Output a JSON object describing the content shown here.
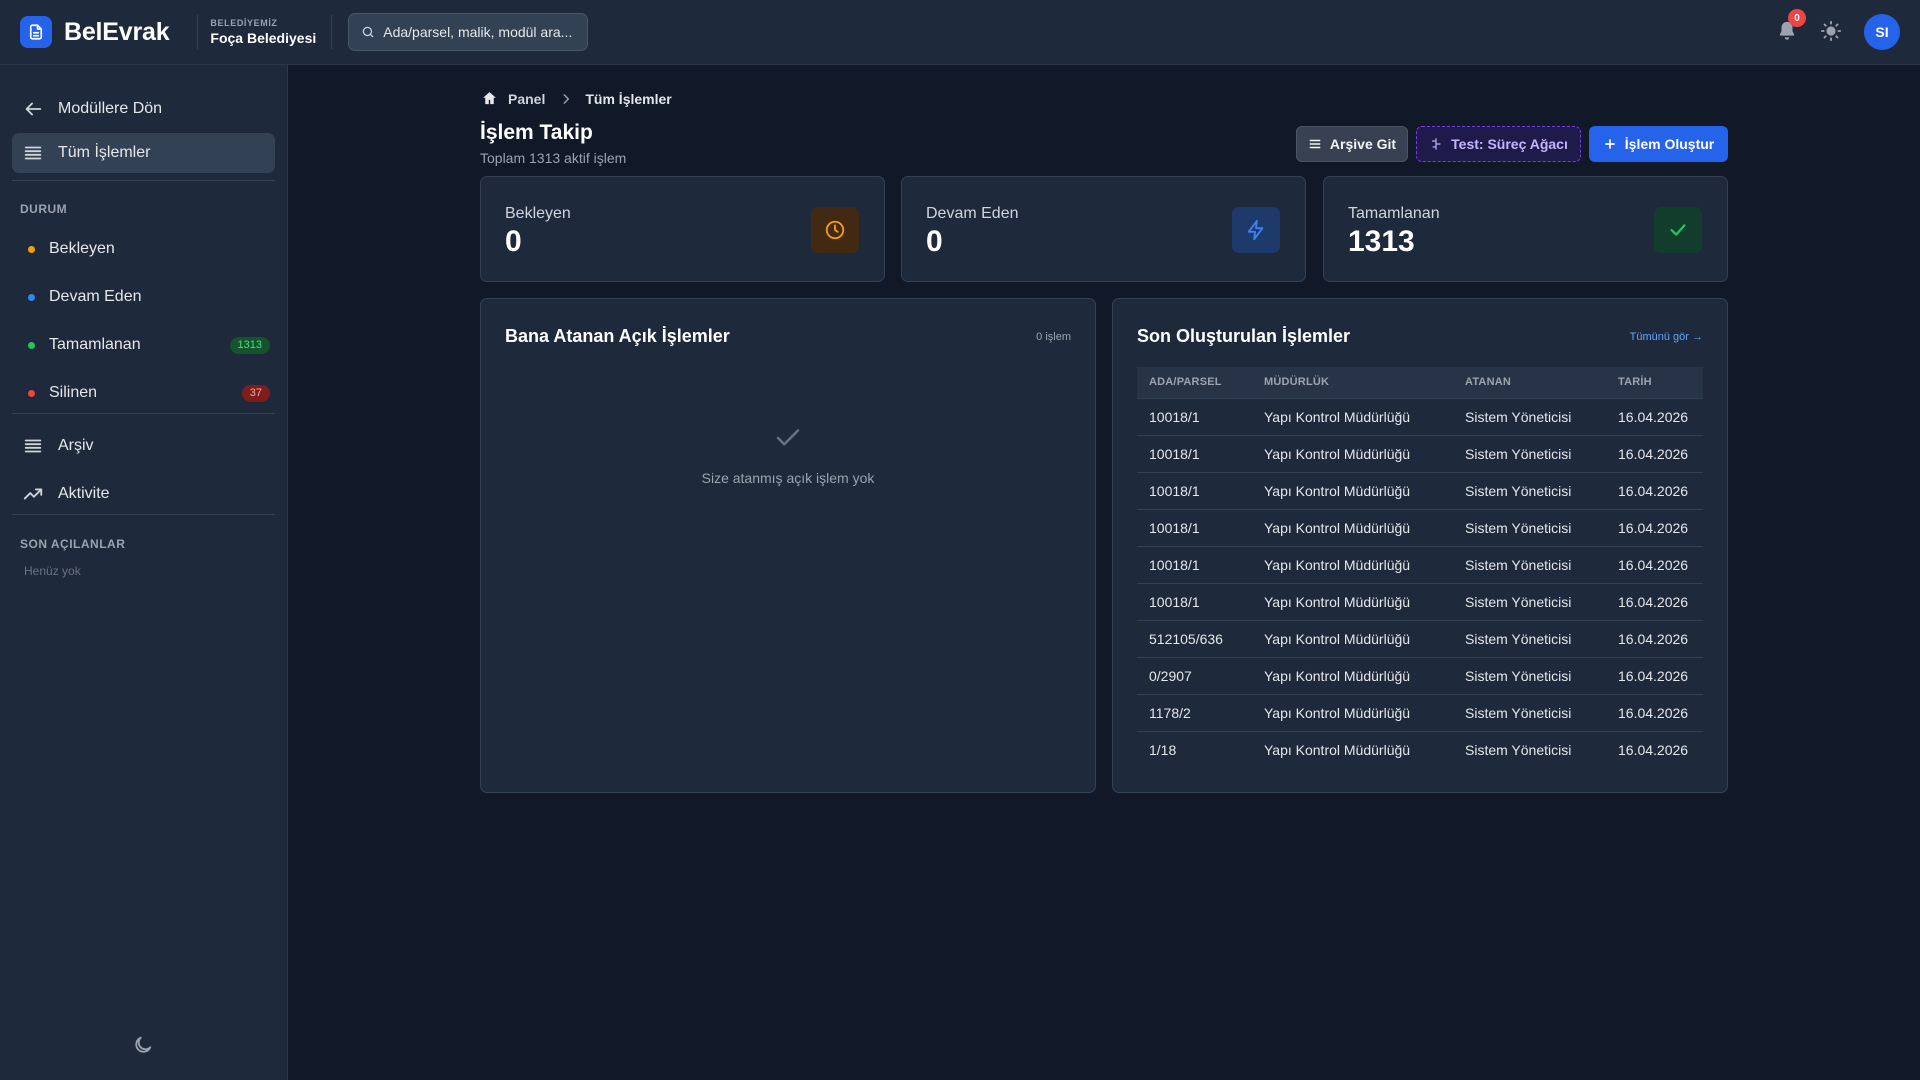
{
  "app": {
    "name": "BelEvrak",
    "municipality_eyebrow": "BELEDİYEMİZ",
    "municipality_name": "Foça Belediyesi"
  },
  "search": {
    "placeholder": "Ada/parsel, malik, modül ara..."
  },
  "header": {
    "notification_count": "0",
    "avatar_initials": "SI"
  },
  "sidebar": {
    "back_label": "Modüllere Dön",
    "all_label": "Tüm İşlemler",
    "status_heading": "DURUM",
    "statuses": [
      {
        "label": "Bekleyen",
        "color": "#f59e0b",
        "count": ""
      },
      {
        "label": "Devam Eden",
        "color": "#3b82f6",
        "count": ""
      },
      {
        "label": "Tamamlanan",
        "color": "#22c55e",
        "count": "1313"
      },
      {
        "label": "Silinen",
        "color": "#ef4444",
        "count": "37"
      }
    ],
    "archive_label": "Arşiv",
    "activity_label": "Aktivite",
    "recent_heading": "SON AÇILANLAR",
    "recent_empty": "Henüz yok"
  },
  "breadcrumb": {
    "home": "Panel",
    "current": "Tüm İşlemler"
  },
  "page": {
    "title": "İşlem Takip",
    "subtitle": "Toplam 1313 aktif işlem"
  },
  "actions": {
    "archive": "Arşive Git",
    "test": "Test: Süreç Ağacı",
    "create": "İşlem Oluştur"
  },
  "stats": [
    {
      "label": "Bekleyen",
      "value": "0",
      "icon": "clock-icon",
      "color": "#f59e0b"
    },
    {
      "label": "Devam Eden",
      "value": "0",
      "icon": "lightning-icon",
      "color": "#3b82f6"
    },
    {
      "label": "Tamamlanan",
      "value": "1313",
      "icon": "check-icon",
      "color": "#22c55e"
    }
  ],
  "assigned": {
    "title": "Bana Atanan Açık İşlemler",
    "count_label": "0 işlem",
    "empty": "Size atanmış açık işlem yok"
  },
  "recent": {
    "title": "Son Oluşturulan İşlemler",
    "see_all": "Tümünü gör →",
    "columns": [
      "ADA/PARSEL",
      "MÜDÜRLÜK",
      "ATANAN",
      "TARİH"
    ],
    "rows": [
      {
        "parcel": "10018/1",
        "department": "Yapı Kontrol Müdürlüğü",
        "assignee": "Sistem Yöneticisi",
        "date": "16.04.2026"
      },
      {
        "parcel": "10018/1",
        "department": "Yapı Kontrol Müdürlüğü",
        "assignee": "Sistem Yöneticisi",
        "date": "16.04.2026"
      },
      {
        "parcel": "10018/1",
        "department": "Yapı Kontrol Müdürlüğü",
        "assignee": "Sistem Yöneticisi",
        "date": "16.04.2026"
      },
      {
        "parcel": "10018/1",
        "department": "Yapı Kontrol Müdürlüğü",
        "assignee": "Sistem Yöneticisi",
        "date": "16.04.2026"
      },
      {
        "parcel": "10018/1",
        "department": "Yapı Kontrol Müdürlüğü",
        "assignee": "Sistem Yöneticisi",
        "date": "16.04.2026"
      },
      {
        "parcel": "10018/1",
        "department": "Yapı Kontrol Müdürlüğü",
        "assignee": "Sistem Yöneticisi",
        "date": "16.04.2026"
      },
      {
        "parcel": "512105/636",
        "department": "Yapı Kontrol Müdürlüğü",
        "assignee": "Sistem Yöneticisi",
        "date": "16.04.2026"
      },
      {
        "parcel": "0/2907",
        "department": "Yapı Kontrol Müdürlüğü",
        "assignee": "Sistem Yöneticisi",
        "date": "16.04.2026"
      },
      {
        "parcel": "1178/2",
        "department": "Yapı Kontrol Müdürlüğü",
        "assignee": "Sistem Yöneticisi",
        "date": "16.04.2026"
      },
      {
        "parcel": "1/18",
        "department": "Yapı Kontrol Müdürlüğü",
        "assignee": "Sistem Yöneticisi",
        "date": "16.04.2026"
      }
    ]
  },
  "colors": {
    "accent": "#2563eb",
    "background": "#111827",
    "panel": "#1e293b",
    "link": "#60a5fa"
  }
}
